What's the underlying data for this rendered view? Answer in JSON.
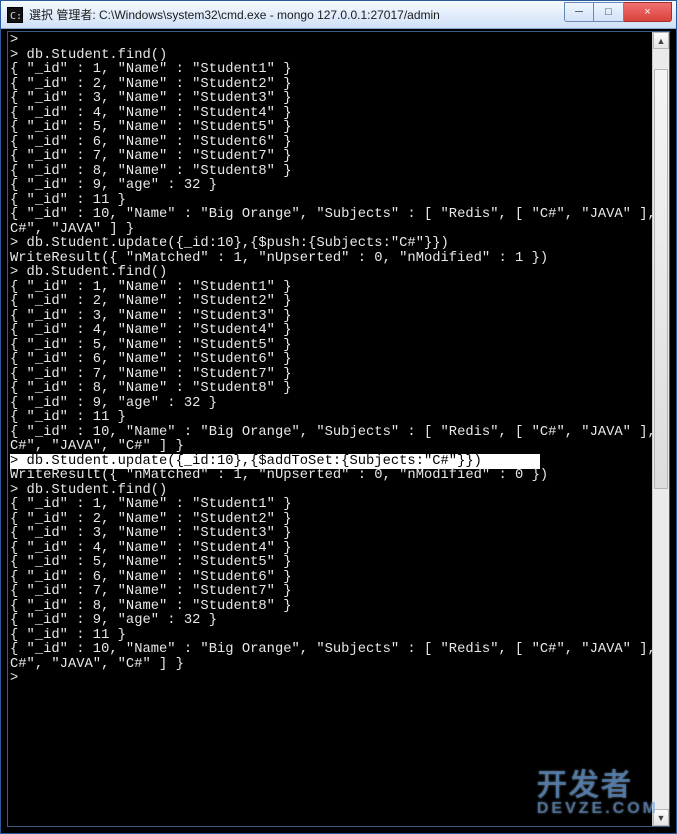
{
  "window": {
    "title": "選択 管理者: C:\\Windows\\system32\\cmd.exe - mongo  127.0.0.1:27017/admin",
    "buttons": {
      "minimize": "─",
      "maximize": "□",
      "close": "×"
    }
  },
  "scrollbar": {
    "up": "▲",
    "down": "▼"
  },
  "watermark": {
    "main": "开发者",
    "sub": "DEVZE.COM"
  },
  "terminal_lines": [
    {
      "t": ">"
    },
    {
      "t": "> db.Student.find()"
    },
    {
      "t": "{ \"_id\" : 1, \"Name\" : \"Student1\" }"
    },
    {
      "t": "{ \"_id\" : 2, \"Name\" : \"Student2\" }"
    },
    {
      "t": "{ \"_id\" : 3, \"Name\" : \"Student3\" }"
    },
    {
      "t": "{ \"_id\" : 4, \"Name\" : \"Student4\" }"
    },
    {
      "t": "{ \"_id\" : 5, \"Name\" : \"Student5\" }"
    },
    {
      "t": "{ \"_id\" : 6, \"Name\" : \"Student6\" }"
    },
    {
      "t": "{ \"_id\" : 7, \"Name\" : \"Student7\" }"
    },
    {
      "t": "{ \"_id\" : 8, \"Name\" : \"Student8\" }"
    },
    {
      "t": "{ \"_id\" : 9, \"age\" : 32 }"
    },
    {
      "t": "{ \"_id\" : 11 }"
    },
    {
      "t": "{ \"_id\" : 10, \"Name\" : \"Big Orange\", \"Subjects\" : [ \"Redis\", [ \"C#\", \"JAVA\" ], \""
    },
    {
      "t": "C#\", \"JAVA\" ] }"
    },
    {
      "t": "> db.Student.update({_id:10},{$push:{Subjects:\"C#\"}})"
    },
    {
      "t": "WriteResult({ \"nMatched\" : 1, \"nUpserted\" : 0, \"nModified\" : 1 })"
    },
    {
      "t": "> db.Student.find()"
    },
    {
      "t": "{ \"_id\" : 1, \"Name\" : \"Student1\" }"
    },
    {
      "t": "{ \"_id\" : 2, \"Name\" : \"Student2\" }"
    },
    {
      "t": "{ \"_id\" : 3, \"Name\" : \"Student3\" }"
    },
    {
      "t": "{ \"_id\" : 4, \"Name\" : \"Student4\" }"
    },
    {
      "t": "{ \"_id\" : 5, \"Name\" : \"Student5\" }"
    },
    {
      "t": "{ \"_id\" : 6, \"Name\" : \"Student6\" }"
    },
    {
      "t": "{ \"_id\" : 7, \"Name\" : \"Student7\" }"
    },
    {
      "t": "{ \"_id\" : 8, \"Name\" : \"Student8\" }"
    },
    {
      "t": "{ \"_id\" : 9, \"age\" : 32 }"
    },
    {
      "t": "{ \"_id\" : 11 }"
    },
    {
      "t": "{ \"_id\" : 10, \"Name\" : \"Big Orange\", \"Subjects\" : [ \"Redis\", [ \"C#\", \"JAVA\" ], \""
    },
    {
      "t": "C#\", \"JAVA\", \"C#\" ] }"
    },
    {
      "t": "> db.Student.update({_id:10},{$addToSet:{Subjects:\"C#\"}})",
      "selected": true,
      "extent": 64
    },
    {
      "t": "WriteResult({ \"nMatched\" : 1, \"nUpserted\" : 0, \"nModified\" : 0 })"
    },
    {
      "t": "> db.Student.find()"
    },
    {
      "t": "{ \"_id\" : 1, \"Name\" : \"Student1\" }"
    },
    {
      "t": "{ \"_id\" : 2, \"Name\" : \"Student2\" }"
    },
    {
      "t": "{ \"_id\" : 3, \"Name\" : \"Student3\" }"
    },
    {
      "t": "{ \"_id\" : 4, \"Name\" : \"Student4\" }"
    },
    {
      "t": "{ \"_id\" : 5, \"Name\" : \"Student5\" }"
    },
    {
      "t": "{ \"_id\" : 6, \"Name\" : \"Student6\" }"
    },
    {
      "t": "{ \"_id\" : 7, \"Name\" : \"Student7\" }"
    },
    {
      "t": "{ \"_id\" : 8, \"Name\" : \"Student8\" }"
    },
    {
      "t": "{ \"_id\" : 9, \"age\" : 32 }"
    },
    {
      "t": "{ \"_id\" : 11 }"
    },
    {
      "t": "{ \"_id\" : 10, \"Name\" : \"Big Orange\", \"Subjects\" : [ \"Redis\", [ \"C#\", \"JAVA\" ], \""
    },
    {
      "t": "C#\", \"JAVA\", \"C#\" ] }"
    },
    {
      "t": ">"
    }
  ]
}
